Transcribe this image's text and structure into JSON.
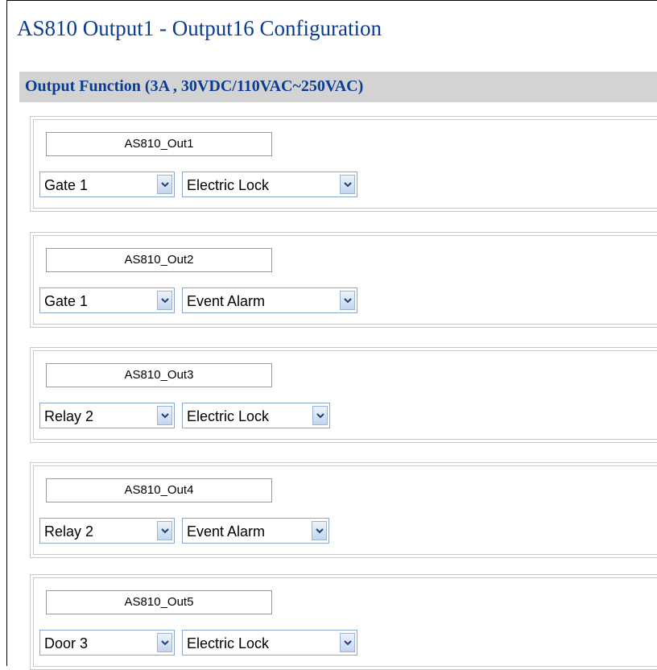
{
  "page": {
    "title": "AS810 Output1 - Output16 Configuration",
    "section_title": "Output Function (3A , 30VDC/110VAC~250VAC)"
  },
  "outputs": [
    {
      "name": "AS810_Out1",
      "source": "Gate 1",
      "function": "Electric Lock"
    },
    {
      "name": "AS810_Out2",
      "source": "Gate 1",
      "function": "Event Alarm"
    },
    {
      "name": "AS810_Out3",
      "source": "Relay 2",
      "function": "Electric Lock"
    },
    {
      "name": "AS810_Out4",
      "source": "Relay 2",
      "function": "Event Alarm"
    },
    {
      "name": "AS810_Out5",
      "source": "Door 3",
      "function": "Electric Lock"
    }
  ],
  "icons": {
    "dropdown": "chevron-down-icon"
  },
  "colors": {
    "title": "#0a3d91",
    "section_bar": "#d3d3d3"
  }
}
